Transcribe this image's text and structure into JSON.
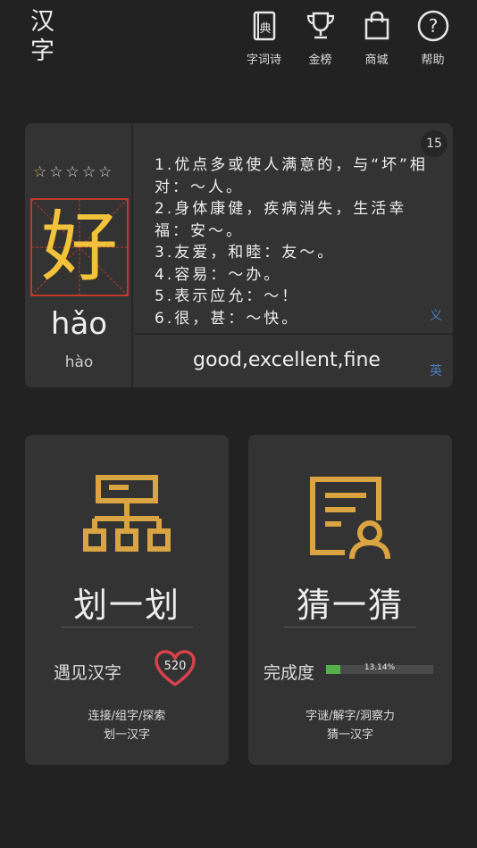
{
  "app": {
    "title_line1": "汉",
    "title_line2": "字"
  },
  "nav": [
    {
      "icon": "dictionary-icon",
      "label": "字词诗"
    },
    {
      "icon": "trophy-icon",
      "label": "金榜"
    },
    {
      "icon": "shopping-bag-icon",
      "label": "商城"
    },
    {
      "icon": "help-icon",
      "label": "帮助"
    }
  ],
  "word": {
    "character": "好",
    "pinyin": "hǎo",
    "alt_pinyin": "hào",
    "rating": 0.5,
    "rating_max": 5,
    "count": "15",
    "meanings": [
      "1.优点多或使人满意的，与“坏”相对：～人。",
      "2.身体康健，疾病消失，生活幸福：安～。",
      "3.友爱，和睦：友～。",
      "4.容易：～办。",
      "5.表示应允：～！",
      "6.很，甚：～快。"
    ],
    "meaning_tag": "义",
    "english": "good,excellent,fine",
    "english_tag": "英"
  },
  "tiles": {
    "stroke": {
      "icon": "hierarchy-icon",
      "title": "划一划",
      "stat_label": "遇见汉字",
      "stat_value": "520",
      "desc_line1": "连接/组字/探索",
      "desc_line2": "划一汉字"
    },
    "guess": {
      "icon": "document-user-icon",
      "title": "猜一猜",
      "progress_label": "完成度",
      "progress_value": 0.1314,
      "progress_text": "13.14%",
      "desc_line1": "字谜/解字/洞察力",
      "desc_line2": "猜一汉字"
    }
  },
  "colors": {
    "background": "#222222",
    "card": "#333333",
    "accent_gold": "#d9a441",
    "char_yellow": "#f2c33a",
    "grid_red": "#c0392b",
    "heart_red": "#d9414a",
    "progress_green": "#54b04a",
    "tag_blue": "#4a7fc0"
  }
}
